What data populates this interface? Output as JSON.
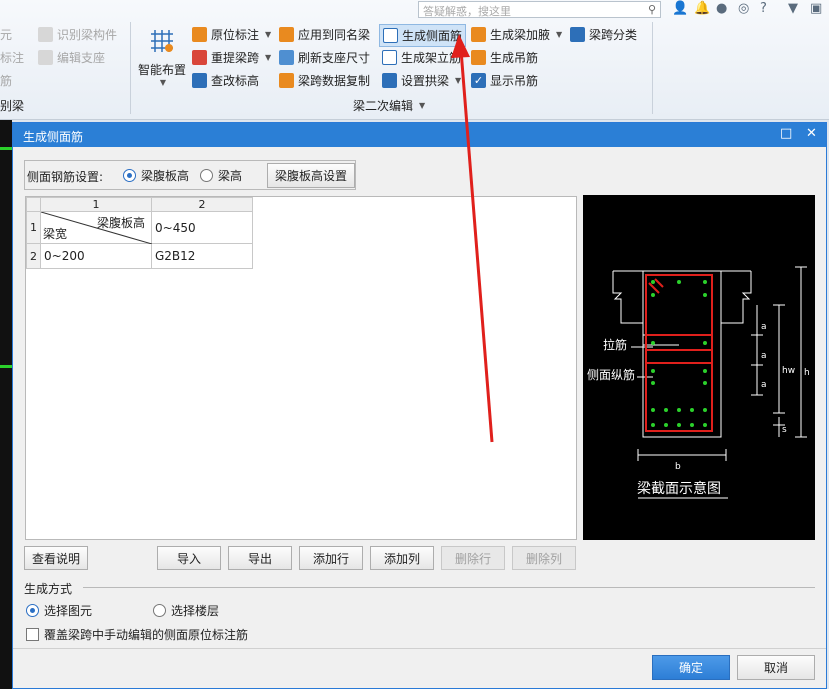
{
  "ribbon": {
    "search_placeholder": "答疑解惑，搜这里",
    "left_items": [
      {
        "label": "元"
      },
      {
        "label": "识别梁构件"
      },
      {
        "label": "标注"
      },
      {
        "label": "编辑支座"
      },
      {
        "label": "筋"
      }
    ],
    "left_group_label": "别梁",
    "smart_layout": "智能布置",
    "col1": [
      "原位标注",
      "重提梁跨",
      "查改标高"
    ],
    "col2": [
      "应用到同名梁",
      "刷新支座尺寸",
      "梁跨数据复制"
    ],
    "col3": [
      "生成侧面筋",
      "生成架立筋",
      "设置拱梁"
    ],
    "col4": [
      "生成梁加腋",
      "生成吊筋",
      "显示吊筋"
    ],
    "col5": [
      "梁跨分类"
    ],
    "group_label": "梁二次编辑"
  },
  "dialog": {
    "title": "生成侧面筋",
    "setting_label": "侧面钢筋设置:",
    "radio_web_height": "梁腹板高",
    "radio_beam_height": "梁高",
    "web_height_settings_button": "梁腹板高设置",
    "table": {
      "col_headers": [
        "1",
        "2"
      ],
      "row_headers": [
        "1",
        "2"
      ],
      "corner_top": "梁腹板高",
      "corner_bottom": "梁宽",
      "cell_1_2": "0~450",
      "cell_2_1": "0~200",
      "cell_2_2": "G2B12"
    },
    "diagram": {
      "label_tie": "拉筋",
      "label_side": "侧面纵筋",
      "label_a1": "a",
      "label_a2": "a",
      "label_a3": "a",
      "label_hw": "hw",
      "label_h": "h",
      "label_s": "s",
      "label_b": "b",
      "caption": "梁截面示意图"
    },
    "buttons": {
      "view_help": "查看说明",
      "import": "导入",
      "export": "导出",
      "add_row": "添加行",
      "add_col": "添加列",
      "delete_row": "删除行",
      "delete_col": "删除列",
      "ok": "确定",
      "cancel": "取消"
    },
    "gen_mode_label": "生成方式",
    "mode_select_element": "选择图元",
    "mode_select_floor": "选择楼层",
    "override_checkbox": "覆盖梁跨中手动编辑的侧面原位标注筋"
  }
}
